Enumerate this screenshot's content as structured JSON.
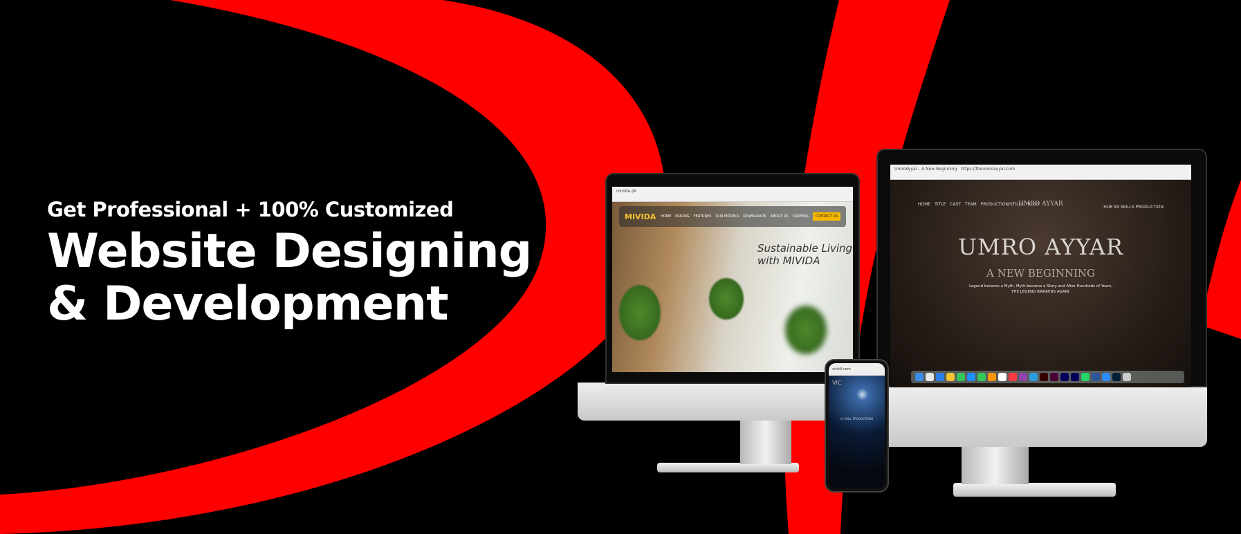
{
  "headline": {
    "line1": "Get Professional + 100% Customized",
    "line2": "Website Designing",
    "line3": "& Development"
  },
  "colors": {
    "background": "#000000",
    "accent": "#ff0000",
    "text": "#ffffff"
  },
  "left_monitor": {
    "url": "mivida.pk",
    "logo": "MIVIDA",
    "nav": [
      "HOME",
      "PRICING",
      "FEATURES",
      "OUR MODELS",
      "DOWNLOADS",
      "ABOUT US",
      "CAREERS"
    ],
    "cta": "CONTACT US",
    "tagline_1": "Sustainable Living",
    "tagline_2": "with MIVIDA"
  },
  "right_monitor": {
    "tab": "UmroAyyar - A New Beginning",
    "url": "https://theumroayyar.com",
    "nav": "HOME TITLE CAST TEAM PRODUCTION/STILLS BLOG",
    "nav_right": "HUB 99 SKILLS PRODUCTION",
    "logo": "UMRO AYYAR",
    "subtitle": "A NEW BEGINNING",
    "line1": "Legend became a Myth, Myth became a Story and After Hundreds of Years,",
    "line2": "THE LEGEND AWAKENS AGAIN."
  },
  "phone": {
    "url": "vichill.com",
    "logo": "VIC",
    "heading": "VI CHILL PRODUCTIONS"
  }
}
